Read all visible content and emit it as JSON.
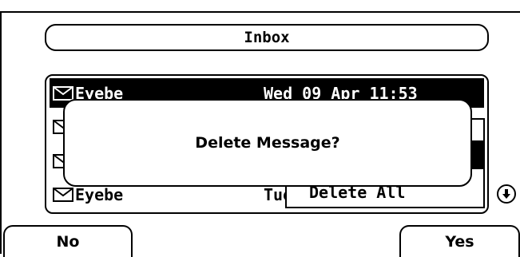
{
  "header": {
    "title": "Inbox"
  },
  "inbox": {
    "rows": [
      {
        "sender": "Eyebe",
        "date": "Wed 09 Apr 11:53"
      },
      {
        "sender": "",
        "date": ""
      },
      {
        "sender": "",
        "date": ""
      },
      {
        "sender": "Eyebe",
        "date": "Tue"
      }
    ]
  },
  "context_menu": {
    "visible_item": "Delete All"
  },
  "dialog": {
    "message": "Delete Message?"
  },
  "softkeys": {
    "left": "No",
    "right": "Yes"
  }
}
